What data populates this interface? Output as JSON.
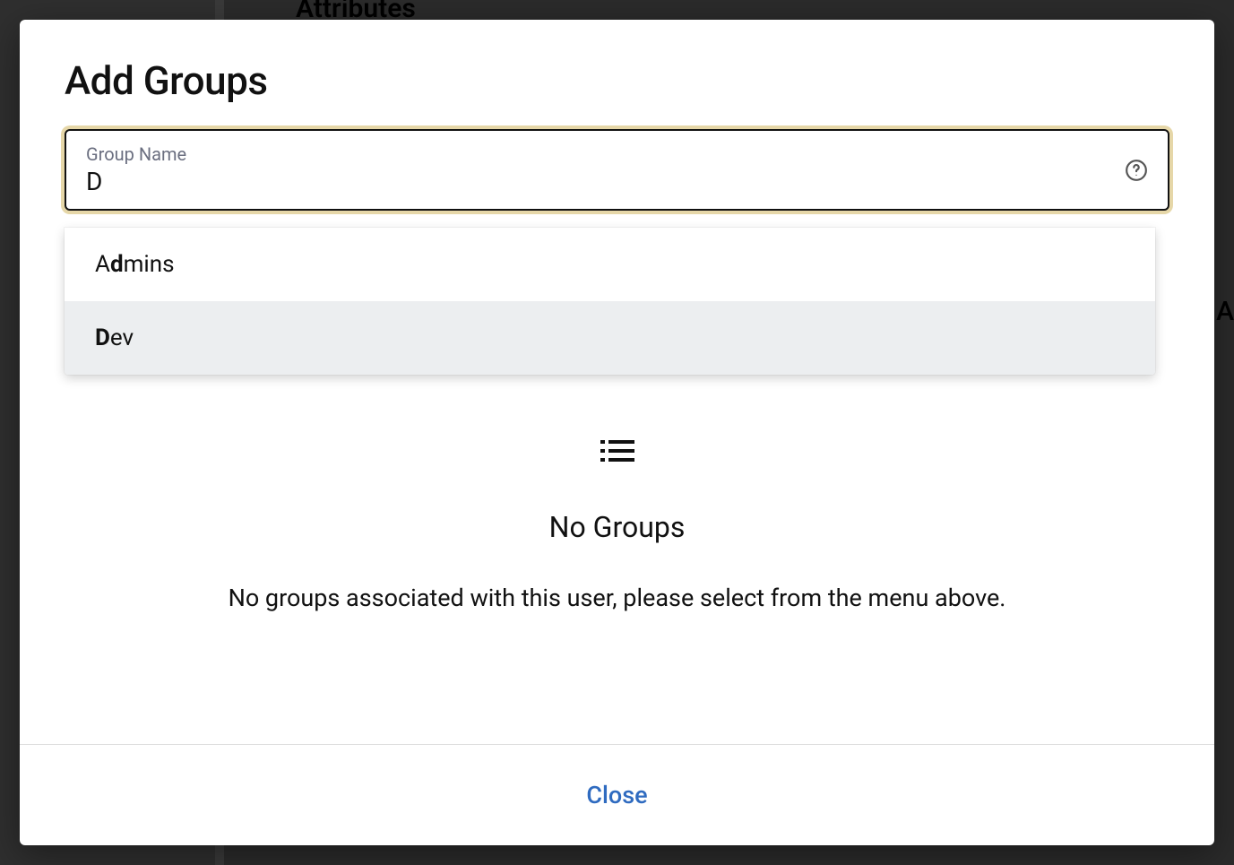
{
  "backdrop": {
    "tab_label": "Attributes",
    "right_peek": "A"
  },
  "dialog": {
    "title": "Add Groups",
    "input": {
      "label": "Group Name",
      "value": "D"
    },
    "suggestions": [
      {
        "pre": "A",
        "match": "d",
        "post": "mins",
        "highlighted": false
      },
      {
        "pre": "",
        "match": "D",
        "post": "ev",
        "highlighted": true
      }
    ],
    "empty_state": {
      "title": "No Groups",
      "description": "No groups associated with this user, please select from the menu above."
    },
    "footer": {
      "close_label": "Close"
    }
  }
}
